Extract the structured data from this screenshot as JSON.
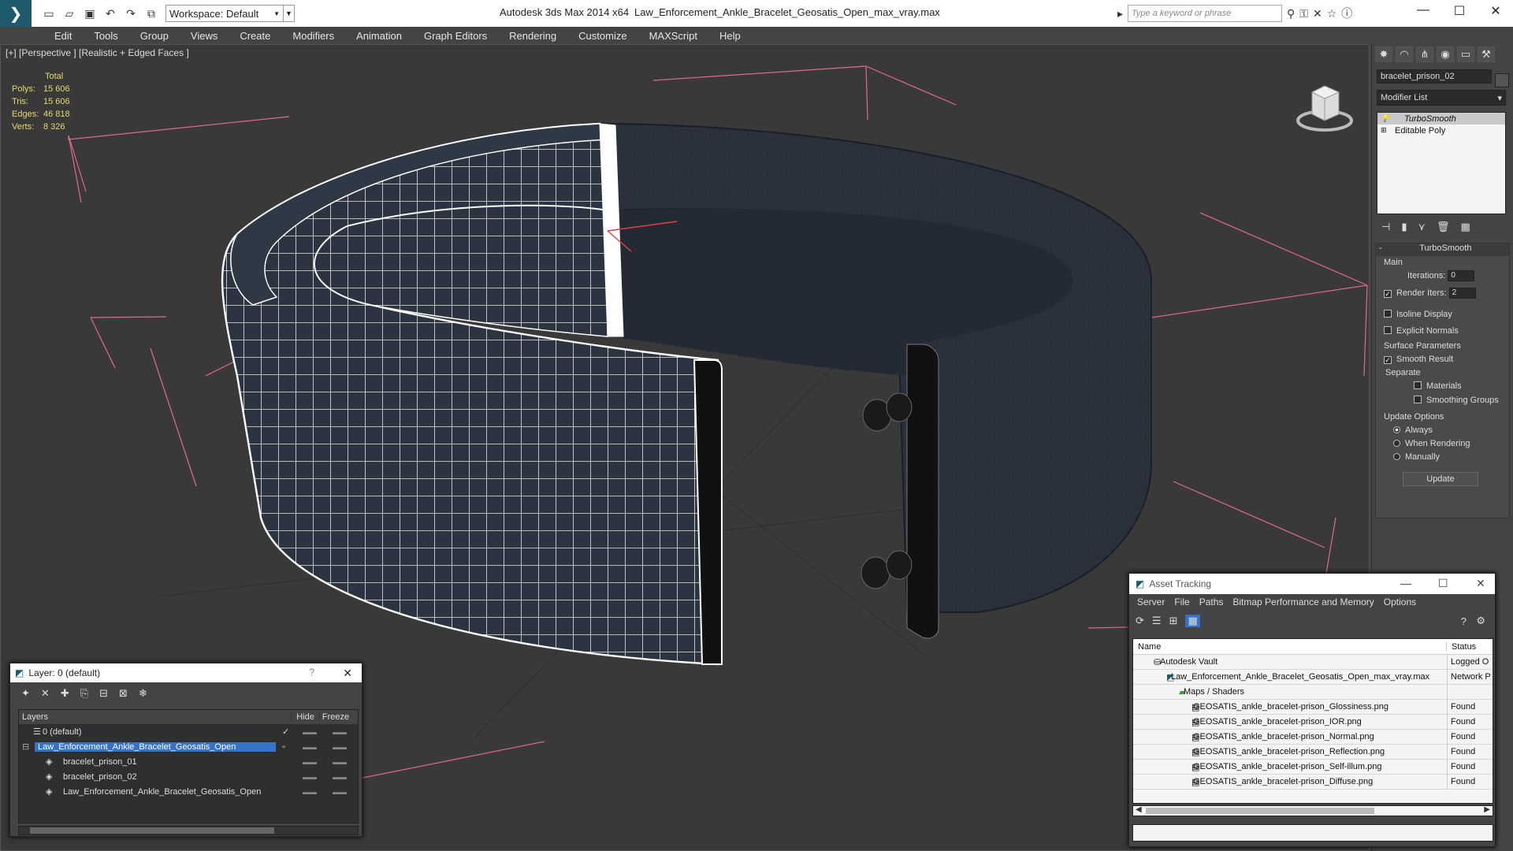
{
  "titlebar": {
    "app": "Autodesk 3ds Max  2014 x64",
    "file": "Law_Enforcement_Ankle_Bracelet_Geosatis_Open_max_vray.max",
    "workspace": "Workspace: Default",
    "search_placeholder": "Type a keyword or phrase"
  },
  "menu": [
    "Edit",
    "Tools",
    "Group",
    "Views",
    "Create",
    "Modifiers",
    "Animation",
    "Graph Editors",
    "Rendering",
    "Customize",
    "MAXScript",
    "Help"
  ],
  "viewport": {
    "label": "[+] [Perspective ] [Realistic + Edged Faces ]",
    "stats": {
      "header": "Total",
      "rows": [
        {
          "k": "Polys:",
          "v": "15 606"
        },
        {
          "k": "Tris:",
          "v": "15 606"
        },
        {
          "k": "Edges:",
          "v": "46 818"
        },
        {
          "k": "Verts:",
          "v": "8 326"
        }
      ]
    }
  },
  "cmdpanel": {
    "object_name": "bracelet_prison_02",
    "modifier_list": "Modifier List",
    "stack": [
      "TurboSmooth",
      "Editable Poly"
    ],
    "rollout_title": "TurboSmooth",
    "main_label": "Main",
    "iterations_label": "Iterations:",
    "iterations_value": "0",
    "render_iters_label": "Render Iters:",
    "render_iters_value": "2",
    "isoline": "Isoline Display",
    "explicit": "Explicit Normals",
    "surface_label": "Surface Parameters",
    "smooth_result": "Smooth Result",
    "separate": "Separate",
    "materials": "Materials",
    "smoothing_groups": "Smoothing Groups",
    "update_options": "Update Options",
    "always": "Always",
    "when_rendering": "When Rendering",
    "manually": "Manually",
    "update_btn": "Update"
  },
  "layer_window": {
    "title": "Layer: 0 (default)",
    "help": "?",
    "col_layers": "Layers",
    "col_hide": "Hide",
    "col_freeze": "Freeze",
    "rows": [
      {
        "name": "0 (default)",
        "indent": 1
      },
      {
        "name": "Law_Enforcement_Ankle_Bracelet_Geosatis_Open",
        "indent": 1
      },
      {
        "name": "bracelet_prison_01",
        "indent": 2
      },
      {
        "name": "bracelet_prison_02",
        "indent": 2
      },
      {
        "name": "Law_Enforcement_Ankle_Bracelet_Geosatis_Open",
        "indent": 2
      }
    ]
  },
  "asset_window": {
    "title": "Asset Tracking",
    "menu": [
      "Server",
      "File",
      "Paths",
      "Bitmap Performance and Memory",
      "Options"
    ],
    "col_name": "Name",
    "col_status": "Status",
    "rows": [
      {
        "name": "Autodesk Vault",
        "status": "Logged O",
        "indent": 1
      },
      {
        "name": "Law_Enforcement_Ankle_Bracelet_Geosatis_Open_max_vray.max",
        "status": "Network P",
        "indent": 2
      },
      {
        "name": "Maps / Shaders",
        "status": "",
        "indent": 3
      },
      {
        "name": "GEOSATIS_ankle_bracelet-prison_Glossiness.png",
        "status": "Found",
        "indent": 4
      },
      {
        "name": "GEOSATIS_ankle_bracelet-prison_IOR.png",
        "status": "Found",
        "indent": 4
      },
      {
        "name": "GEOSATIS_ankle_bracelet-prison_Normal.png",
        "status": "Found",
        "indent": 4
      },
      {
        "name": "GEOSATIS_ankle_bracelet-prison_Reflection.png",
        "status": "Found",
        "indent": 4
      },
      {
        "name": "GEOSATIS_ankle_bracelet-prison_Self-illum.png",
        "status": "Found",
        "indent": 4
      },
      {
        "name": "GEOSATIS_ankle_bracelet-prison_Diffuse.png",
        "status": "Found",
        "indent": 4
      }
    ]
  }
}
